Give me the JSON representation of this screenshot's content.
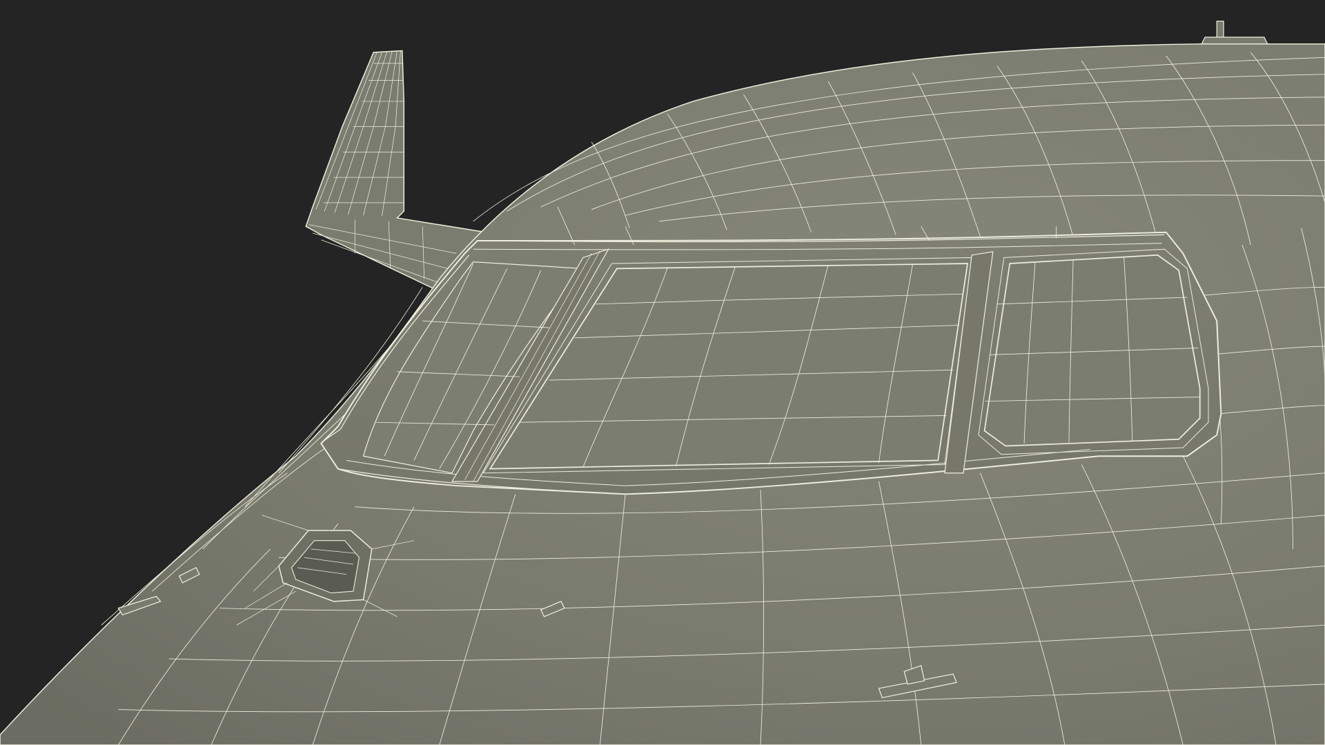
{
  "scene": {
    "subject": "aircraft-nose-wireframe",
    "colors": {
      "background": "#242424",
      "surface": "#7a7b6f",
      "surface_shadow": "#6c6d62",
      "surface_highlight": "#85867a",
      "wire": "#eeeede"
    }
  }
}
